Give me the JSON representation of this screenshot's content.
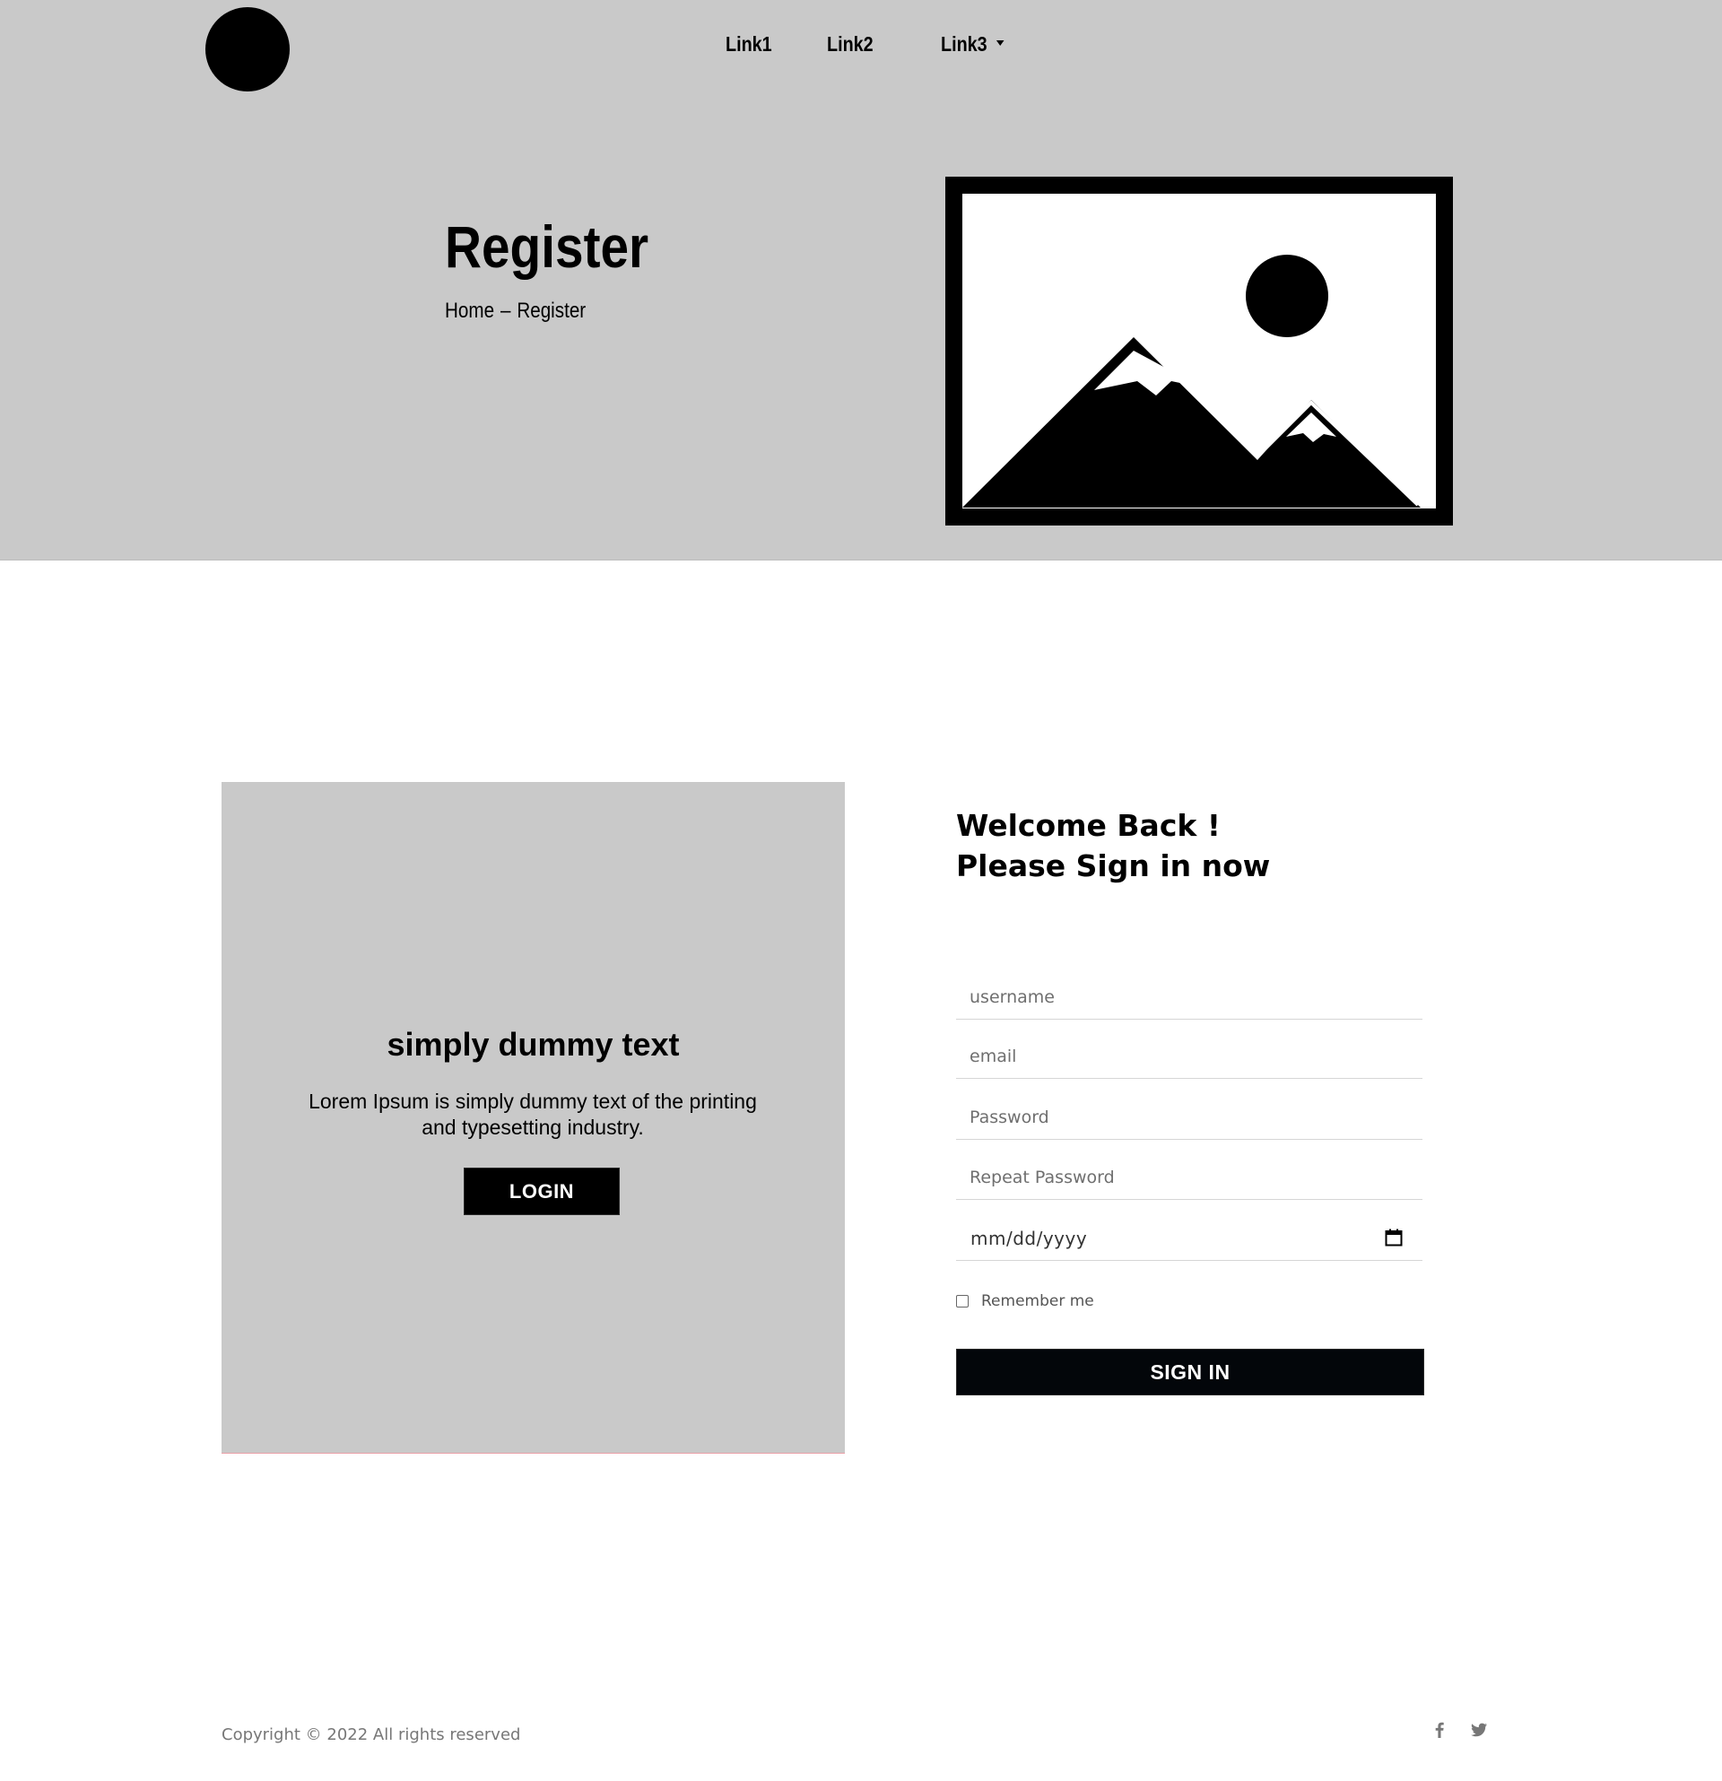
{
  "nav": {
    "links": [
      {
        "label": "Link1"
      },
      {
        "label": "Link2"
      },
      {
        "label": "Link3"
      }
    ]
  },
  "hero": {
    "title": "Register",
    "breadcrumb": {
      "home": "Home",
      "separator": "–",
      "current": "Register"
    },
    "image_icon": "image-placeholder-icon"
  },
  "promo": {
    "title": "simply dummy text",
    "text": "Lorem Ipsum is simply dummy text of the printing and typesetting industry.",
    "button_label": "LOGIN"
  },
  "form": {
    "heading_line1": "Welcome Back !",
    "heading_line2": "Please Sign in now",
    "username_placeholder": "username",
    "email_placeholder": "email",
    "password_placeholder": "Password",
    "repeat_password_placeholder": "Repeat Password",
    "date_placeholder": "mm/dd/yyyy",
    "remember_label": "Remember me",
    "submit_label": "SIGN IN"
  },
  "footer": {
    "copyright": "Copyright © 2022 All rights reserved",
    "social": [
      {
        "icon": "facebook-icon"
      },
      {
        "icon": "twitter-icon"
      }
    ]
  },
  "colors": {
    "hero_bg": "#c9c9c9",
    "button_bg": "#03060a",
    "button_text": "#ffffff",
    "footer_text": "#777777"
  }
}
